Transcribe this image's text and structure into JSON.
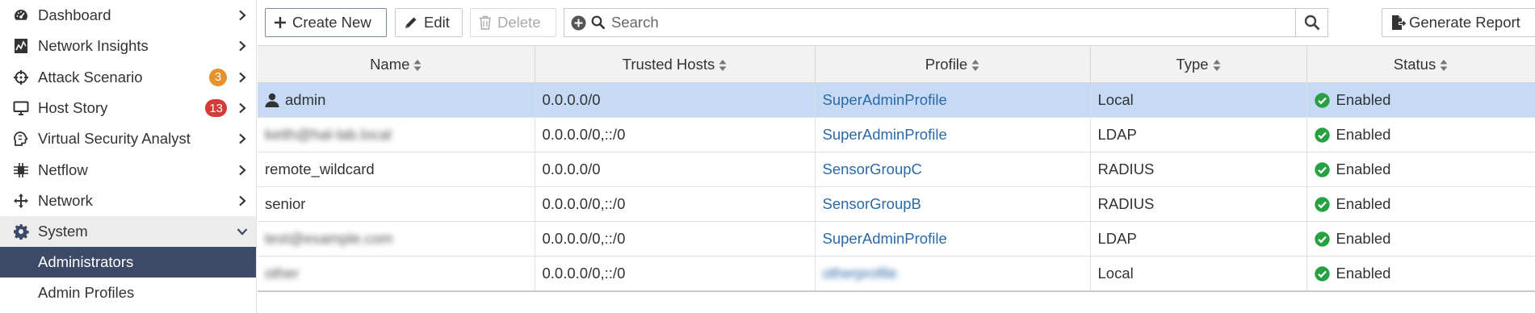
{
  "sidebar": {
    "items": [
      {
        "label": "Dashboard",
        "icon": "dashboard-gauge-icon"
      },
      {
        "label": "Network Insights",
        "icon": "chart-document-icon"
      },
      {
        "label": "Attack Scenario",
        "icon": "crosshair-icon",
        "badge": "3",
        "badge_color": "#e5912d"
      },
      {
        "label": "Host Story",
        "icon": "monitor-icon",
        "badge": "13",
        "badge_color": "#d83a37"
      },
      {
        "label": "Virtual Security Analyst",
        "icon": "brain-head-icon"
      },
      {
        "label": "Netflow",
        "icon": "netflow-icon"
      },
      {
        "label": "Network",
        "icon": "move-arrows-icon"
      },
      {
        "label": "System",
        "icon": "gear-icon",
        "expanded": true
      }
    ],
    "sub_items": [
      {
        "label": "Administrators",
        "active": true
      },
      {
        "label": "Admin Profiles",
        "active": false
      }
    ]
  },
  "toolbar": {
    "create_label": "Create New",
    "edit_label": "Edit",
    "delete_label": "Delete",
    "search_placeholder": "Search",
    "report_label": "Generate Report"
  },
  "table": {
    "columns": [
      "Name",
      "Trusted Hosts",
      "Profile",
      "Type",
      "Status"
    ],
    "rows": [
      {
        "name": "admin",
        "hosts": "0.0.0.0/0",
        "profile": "SuperAdminProfile",
        "type": "Local",
        "status": "Enabled",
        "selected": true,
        "user_icon": true
      },
      {
        "name": "keith@hal-lab.local",
        "hosts": "0.0.0.0/0,::/0",
        "profile": "SuperAdminProfile",
        "type": "LDAP",
        "status": "Enabled",
        "name_blurred": true
      },
      {
        "name": "remote_wildcard",
        "hosts": "0.0.0.0/0",
        "profile": "SensorGroupC",
        "type": "RADIUS",
        "status": "Enabled"
      },
      {
        "name": "senior",
        "hosts": "0.0.0.0/0,::/0",
        "profile": "SensorGroupB",
        "type": "RADIUS",
        "status": "Enabled"
      },
      {
        "name": "test@example.com",
        "hosts": "0.0.0.0/0,::/0",
        "profile": "SuperAdminProfile",
        "type": "LDAP",
        "status": "Enabled",
        "name_blurred": true
      },
      {
        "name": "other",
        "hosts": "0.0.0.0/0,::/0",
        "profile": "otherprofile",
        "type": "Local",
        "status": "Enabled",
        "name_blurred": true,
        "profile_blurred": true
      }
    ]
  },
  "colors": {
    "accent_nav": "#3c4a67",
    "link": "#2a6aa8",
    "status_ok": "#27a243",
    "selected_row": "#c6d9f5"
  }
}
